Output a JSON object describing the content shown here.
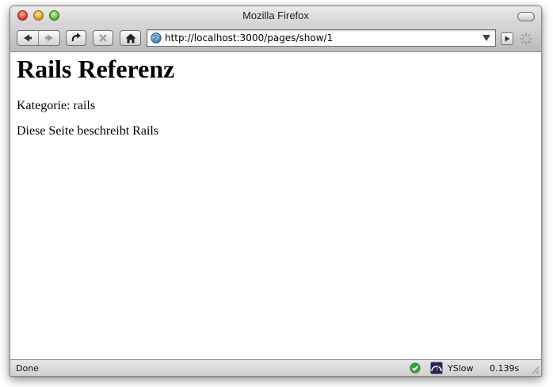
{
  "window": {
    "title": "Mozilla Firefox"
  },
  "toolbar": {
    "back_icon": "back-arrow-icon",
    "forward_icon": "forward-arrow-icon",
    "reload_icon": "reload-icon",
    "stop_icon": "stop-icon",
    "home_icon": "home-icon",
    "url": "http://localhost:3000/pages/show/1",
    "site_icon": "globe-icon"
  },
  "page": {
    "heading": "Rails Referenz",
    "category": "Kategorie: rails",
    "description": "Diese Seite beschreibt Rails"
  },
  "statusbar": {
    "status": "Done",
    "yslow_label": "YSlow",
    "yslow_time": "0.139s"
  },
  "colors": {
    "close": "#e0453a",
    "minimize": "#e6a227",
    "zoom": "#6bbd3c",
    "ok": "#3aa33a"
  }
}
